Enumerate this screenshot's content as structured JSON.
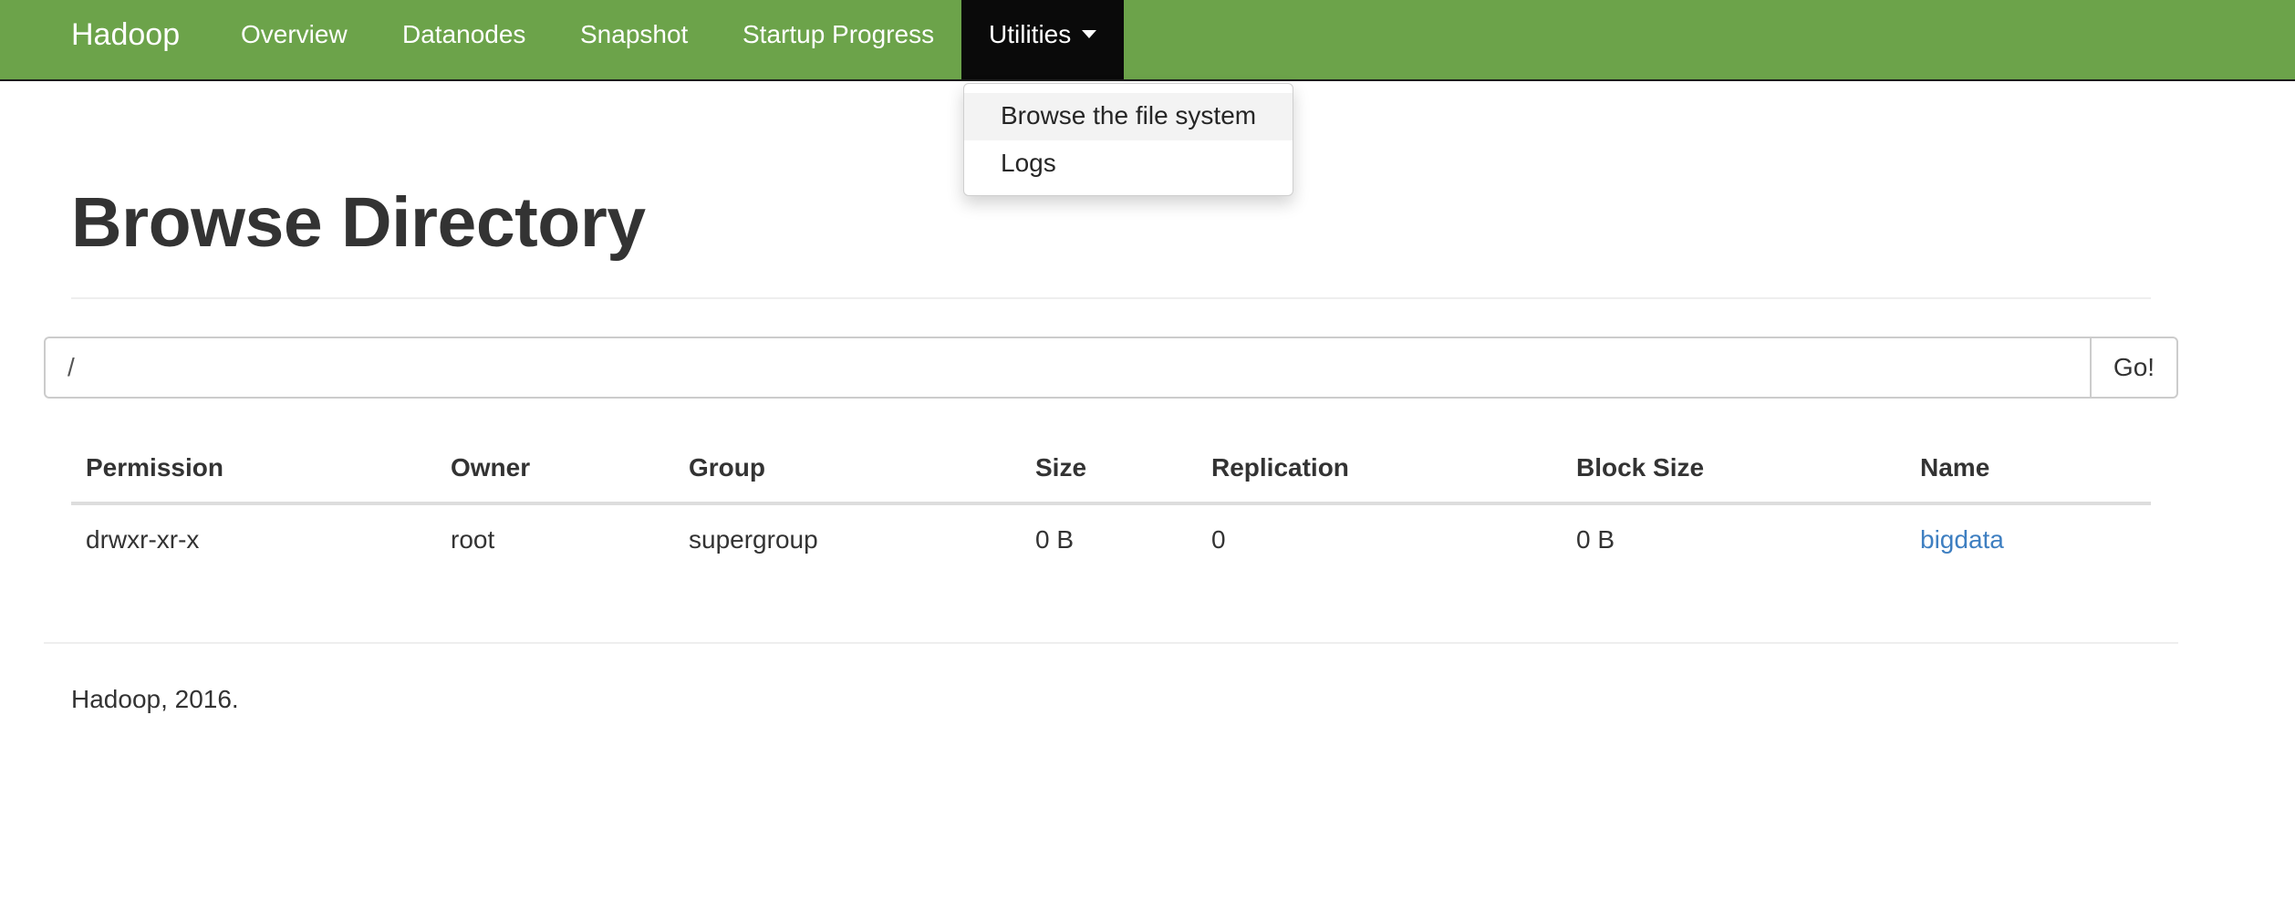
{
  "navbar": {
    "brand": "Hadoop",
    "items": [
      {
        "label": "Overview"
      },
      {
        "label": "Datanodes"
      },
      {
        "label": "Snapshot"
      },
      {
        "label": "Startup Progress"
      },
      {
        "label": "Utilities",
        "icon": "caret-down-icon",
        "open": true
      }
    ],
    "background_color": "#6ca34a",
    "active_color": "#0a0a0a"
  },
  "utilities_menu": {
    "items": [
      {
        "label": "Browse the file system",
        "highlighted": true
      },
      {
        "label": "Logs"
      }
    ]
  },
  "page": {
    "title": "Browse Directory"
  },
  "path_bar": {
    "value": "/",
    "go_label": "Go!"
  },
  "table": {
    "columns": [
      "Permission",
      "Owner",
      "Group",
      "Size",
      "Replication",
      "Block Size",
      "Name"
    ],
    "rows": [
      {
        "permission": "drwxr-xr-x",
        "owner": "root",
        "group": "supergroup",
        "size": "0 B",
        "replication": "0",
        "block_size": "0 B",
        "name": "bigdata"
      }
    ],
    "link_color": "#3e7fc1"
  },
  "footer": {
    "text": "Hadoop, 2016."
  }
}
